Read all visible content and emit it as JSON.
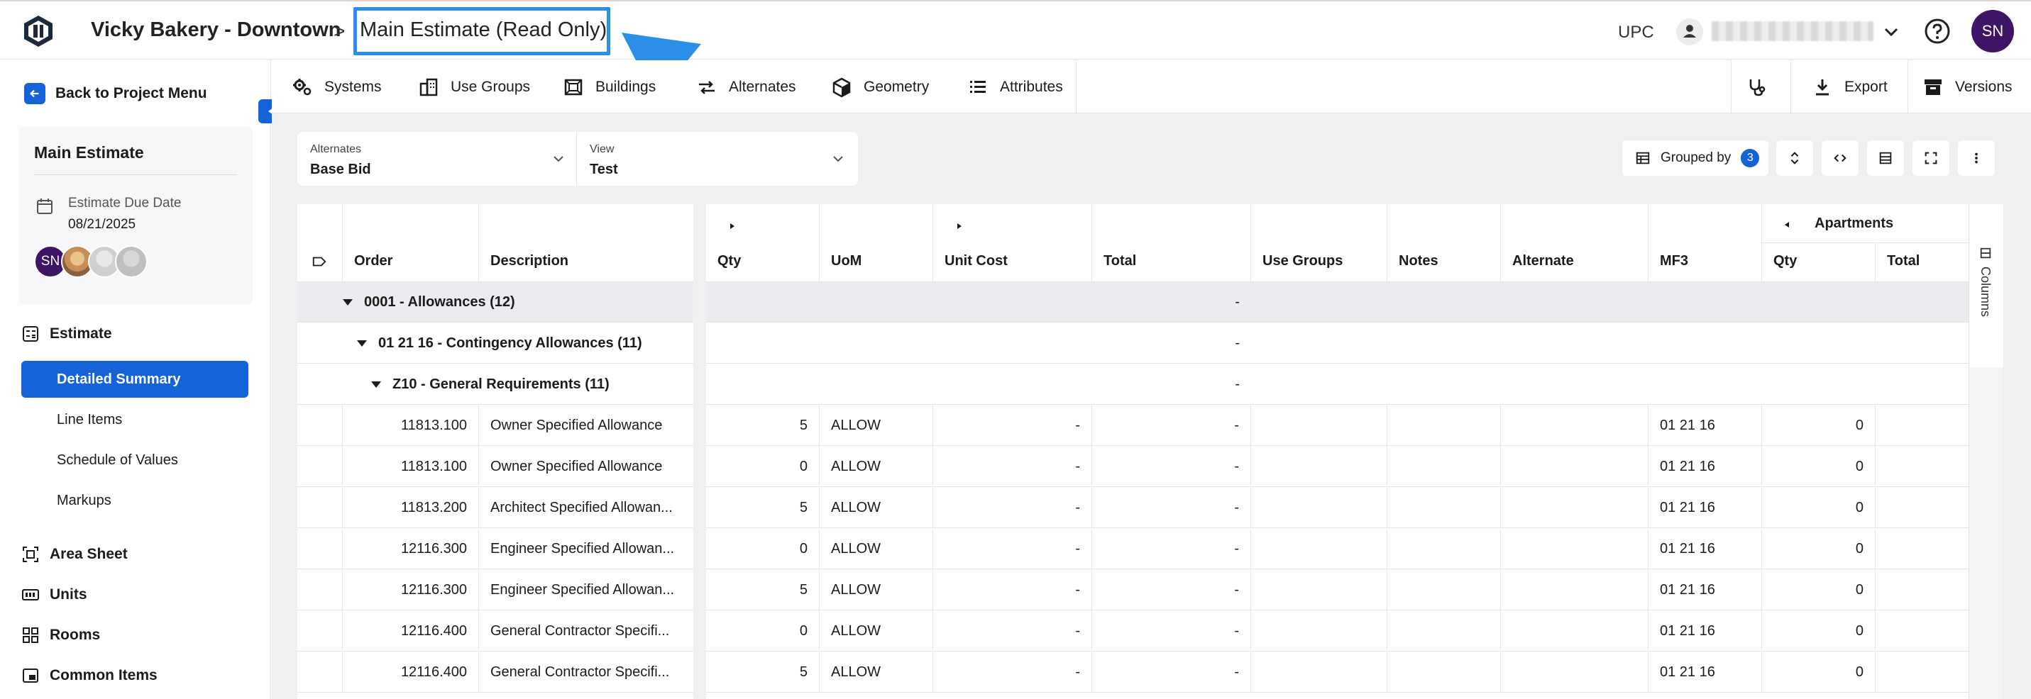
{
  "header": {
    "project": "Vicky Bakery - Downtown",
    "separator": ">",
    "estimate": "Main Estimate (Read Only)",
    "company": "UPC",
    "avatar_initials": "SN"
  },
  "sidebar": {
    "back_label": "Back to Project Menu",
    "card_title": "Main Estimate",
    "due_label": "Estimate Due Date",
    "due_value": "08/21/2025",
    "owner_initials": "SN",
    "estimate_label": "Estimate",
    "sub_items": [
      "Detailed Summary",
      "Line Items",
      "Schedule of Values",
      "Markups"
    ],
    "groups": [
      "Area Sheet",
      "Units",
      "Rooms",
      "Common Items"
    ]
  },
  "toolbar": {
    "items": [
      "Systems",
      "Use Groups",
      "Buildings",
      "Alternates",
      "Geometry",
      "Attributes"
    ],
    "export_label": "Export",
    "versions_label": "Versions"
  },
  "filters": {
    "alternates_label": "Alternates",
    "alternates_value": "Base Bid",
    "view_label": "View",
    "view_value": "Test",
    "grouped_label": "Grouped by",
    "grouped_count": "3"
  },
  "grid": {
    "band_apartments": "Apartments",
    "columns_tab": "Columns",
    "left_headers": [
      "Order",
      "Description"
    ],
    "right_headers": [
      "Qty",
      "UoM",
      "Unit Cost",
      "Total",
      "Use Groups",
      "Notes",
      "Alternate",
      "MF3",
      "Qty",
      "Total"
    ],
    "groups": [
      {
        "label": "0001 - Allowances (12)",
        "total": "-"
      },
      {
        "label": "01 21 16 - Contingency Allowances (11)",
        "total": "-"
      },
      {
        "label": "Z10 - General Requirements (11)",
        "total": "-"
      }
    ],
    "rows": [
      {
        "order": "11813.100",
        "desc": "Owner Specified Allowance",
        "qty": "5",
        "uom": "ALLOW",
        "unit_cost": "-",
        "total": "-",
        "mf3": "01 21 16",
        "apt_qty": "0"
      },
      {
        "order": "11813.100",
        "desc": "Owner Specified Allowance",
        "qty": "0",
        "uom": "ALLOW",
        "unit_cost": "-",
        "total": "-",
        "mf3": "01 21 16",
        "apt_qty": "0"
      },
      {
        "order": "11813.200",
        "desc": "Architect Specified Allowan...",
        "qty": "5",
        "uom": "ALLOW",
        "unit_cost": "-",
        "total": "-",
        "mf3": "01 21 16",
        "apt_qty": "0"
      },
      {
        "order": "12116.300",
        "desc": "Engineer Specified Allowan...",
        "qty": "0",
        "uom": "ALLOW",
        "unit_cost": "-",
        "total": "-",
        "mf3": "01 21 16",
        "apt_qty": "0"
      },
      {
        "order": "12116.300",
        "desc": "Engineer Specified Allowan...",
        "qty": "5",
        "uom": "ALLOW",
        "unit_cost": "-",
        "total": "-",
        "mf3": "01 21 16",
        "apt_qty": "0"
      },
      {
        "order": "12116.400",
        "desc": "General Contractor Specifi...",
        "qty": "0",
        "uom": "ALLOW",
        "unit_cost": "-",
        "total": "-",
        "mf3": "01 21 16",
        "apt_qty": "0"
      },
      {
        "order": "12116.400",
        "desc": "General Contractor Specifi...",
        "qty": "5",
        "uom": "ALLOW",
        "unit_cost": "-",
        "total": "-",
        "mf3": "01 21 16",
        "apt_qty": "0"
      }
    ]
  },
  "colors": {
    "accent": "#1463d8",
    "highlight": "#2b8fe8",
    "avatar": "#3d1466"
  }
}
